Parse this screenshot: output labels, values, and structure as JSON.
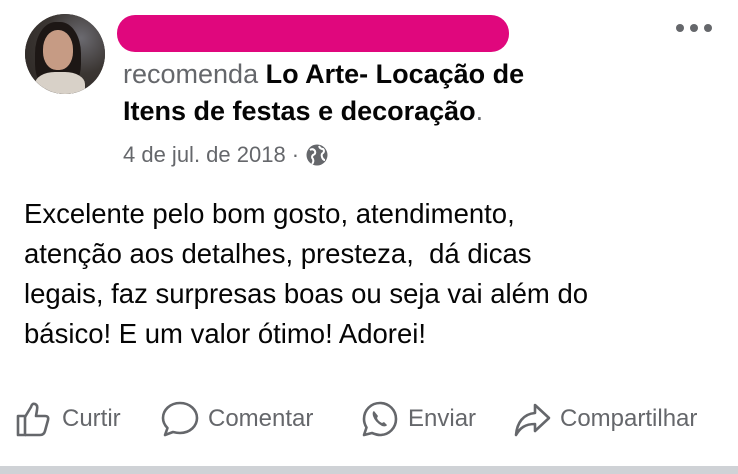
{
  "post": {
    "verb": "recomenda",
    "page_name_line1": "Lo Arte- Locação de",
    "page_name_line2": "Itens de festas e decoração",
    "trailing": ".",
    "date": "4 de jul. de 2018",
    "separator": "·",
    "privacy_icon": "globe-icon",
    "review_lines": [
      "Excelente pelo bom gosto, atendimento,",
      "atenção aos detalhes, presteza,  dá dicas",
      "legais, faz surpresas boas ou seja vai além do",
      "básico! E um valor ótimo! Adorei!"
    ],
    "redaction_color": "#e0077d"
  },
  "actions": {
    "like": "Curtir",
    "comment": "Comentar",
    "send": "Enviar",
    "share": "Compartilhar"
  },
  "colors": {
    "secondary_text": "#65676b",
    "primary_text": "#050505"
  }
}
